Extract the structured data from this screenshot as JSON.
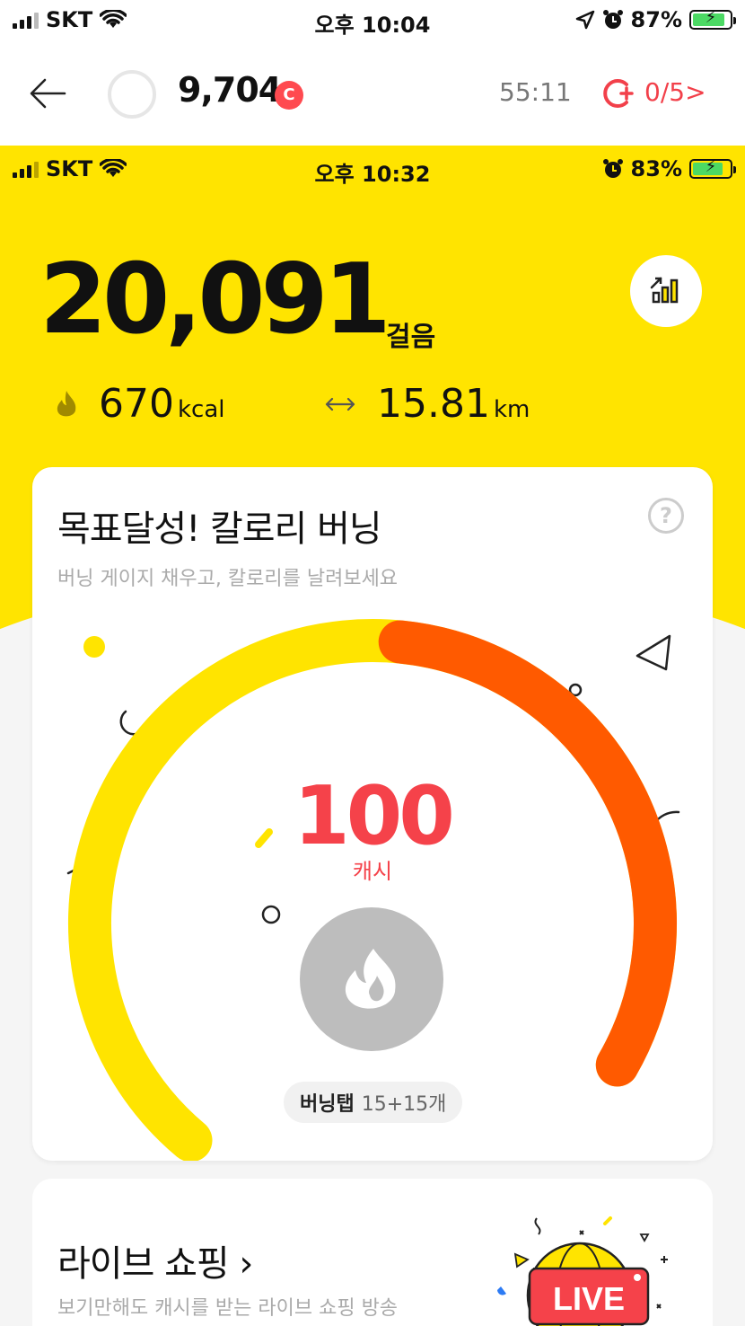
{
  "outer_status": {
    "carrier": "SKT",
    "time": "오후 10:04",
    "battery": "87%"
  },
  "appbar": {
    "points": "9,704",
    "coin_letter": "C",
    "timer": "55:11",
    "mission": "0/5>"
  },
  "inner_status": {
    "carrier": "SKT",
    "time": "오후 10:32",
    "battery": "83%"
  },
  "pedometer": {
    "steps": "20,091",
    "steps_unit": "걸음",
    "kcal_value": "670",
    "kcal_unit": "kcal",
    "distance_value": "15.81",
    "distance_unit": "km"
  },
  "burn_card": {
    "title": "목표달성! 칼로리 버닝",
    "subtitle": "버닝 게이지 채우고, 칼로리를 날려보세요",
    "help": "?",
    "cash_value": "100",
    "cash_label": "캐시",
    "gauge_level": 0.75,
    "tap_label": "버닝탭",
    "tap_count": "15+15개",
    "colors": {
      "gauge_yellow": "#ffe400",
      "gauge_orange": "#ff5a00"
    }
  },
  "live_card": {
    "title": "라이브 쇼핑 ›",
    "subtitle": "보기만해도 캐시를 받는 라이브 쇼핑 방송",
    "badge": "LIVE"
  },
  "colors": {
    "brand_yellow": "#ffe400",
    "accent_red": "#f5424a"
  }
}
